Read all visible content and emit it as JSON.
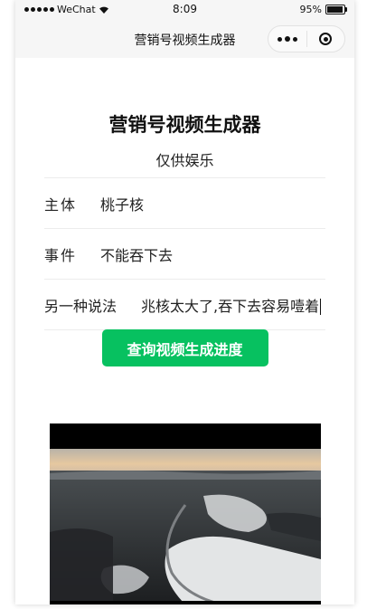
{
  "status_bar": {
    "carrier": "WeChat",
    "time": "8:09",
    "battery": "95%",
    "battery_level": 0.95
  },
  "nav": {
    "title": "营销号视频生成器"
  },
  "header": {
    "title": "营销号视频生成器",
    "subtitle": "仅供娱乐"
  },
  "form": {
    "subject": {
      "label": "主体",
      "value": "桃子核"
    },
    "event": {
      "label": "事件",
      "value": "不能吞下去"
    },
    "alt": {
      "label": "另一种说法",
      "value": "兆核太大了,吞下去容易噎着"
    }
  },
  "button": {
    "label": "查询视频生成进度"
  },
  "colors": {
    "accent": "#07c160",
    "nav_bg": "#f6f6f6"
  },
  "icons": {
    "more": "more-dots-icon",
    "close": "target-close-icon",
    "wifi": "wifi-icon",
    "battery": "battery-icon"
  }
}
